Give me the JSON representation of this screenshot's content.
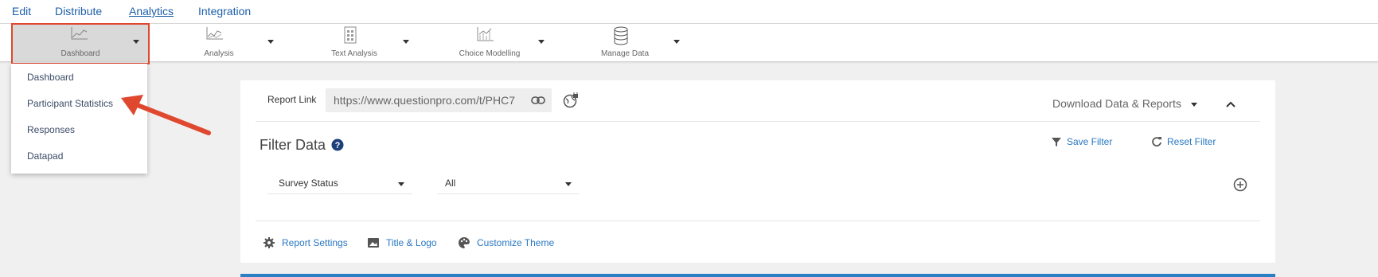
{
  "menu": {
    "items": [
      "Edit",
      "Distribute",
      "Analytics",
      "Integration"
    ],
    "active": "Analytics"
  },
  "toolbar": {
    "tools": [
      {
        "label": "Dashboard",
        "icon": "line-chart-icon"
      },
      {
        "label": "Analysis",
        "icon": "scatter-chart-icon"
      },
      {
        "label": "Text Analysis",
        "icon": "document-grid-icon"
      },
      {
        "label": "Choice Modelling",
        "icon": "trend-chart-icon"
      },
      {
        "label": "Manage Data",
        "icon": "database-icon"
      }
    ]
  },
  "dropdown": {
    "items": [
      "Dashboard",
      "Participant Statistics",
      "Responses",
      "Datapad"
    ]
  },
  "report": {
    "link_label": "Report Link",
    "link_value": "https://www.questionpro.com/t/PHC7",
    "download_label": "Download Data & Reports"
  },
  "filter": {
    "title": "Filter Data",
    "save_label": "Save Filter",
    "reset_label": "Reset Filter",
    "field_value": "Survey Status",
    "condition_value": "All"
  },
  "bottom_links": [
    "Report Settings",
    "Title & Logo",
    "Customize Theme"
  ],
  "colors": {
    "link": "#2a78c2",
    "highlight": "#e0472f",
    "accent_bar": "#2b7fc4"
  }
}
